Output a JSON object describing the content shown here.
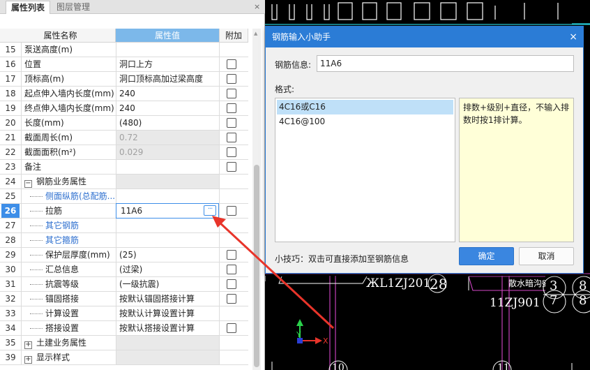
{
  "panel": {
    "tabs": [
      "属性列表",
      "图层管理"
    ],
    "close_icon": "×",
    "columns": {
      "name": "属性名称",
      "value": "属性值",
      "extra": "附加"
    },
    "rows": [
      {
        "num": "15",
        "name": "泵送高度(m)",
        "value": "",
        "check": false,
        "style": ""
      },
      {
        "num": "16",
        "name": "位置",
        "value": "洞口上方",
        "check": true,
        "style": ""
      },
      {
        "num": "17",
        "name": "顶标高(m)",
        "value": "洞口顶标高加过梁高度",
        "check": true,
        "style": ""
      },
      {
        "num": "18",
        "name": "起点伸入墙内长度(mm)",
        "value": "240",
        "check": true,
        "style": ""
      },
      {
        "num": "19",
        "name": "终点伸入墙内长度(mm)",
        "value": "240",
        "check": true,
        "style": ""
      },
      {
        "num": "20",
        "name": "长度(mm)",
        "value": "(480)",
        "check": true,
        "style": ""
      },
      {
        "num": "21",
        "name": "截面周长(m)",
        "value": "0.72",
        "check": true,
        "style": "gray"
      },
      {
        "num": "22",
        "name": "截面面积(m²)",
        "value": "0.029",
        "check": true,
        "style": "gray"
      },
      {
        "num": "23",
        "name": "备注",
        "value": "",
        "check": true,
        "style": ""
      },
      {
        "num": "24",
        "name": "钢筋业务属性",
        "value": "",
        "check": false,
        "style": "group-open"
      },
      {
        "num": "25",
        "name": "侧面纵筋(总配筋...",
        "value": "",
        "check": false,
        "style": "child-blue"
      },
      {
        "num": "26",
        "name": "拉筋",
        "value": "11A6",
        "check": true,
        "style": "child-active"
      },
      {
        "num": "27",
        "name": "其它钢筋",
        "value": "",
        "check": false,
        "style": "child-blue"
      },
      {
        "num": "28",
        "name": "其它箍筋",
        "value": "",
        "check": false,
        "style": "child-blue"
      },
      {
        "num": "29",
        "name": "保护层厚度(mm)",
        "value": "(25)",
        "check": true,
        "style": "child"
      },
      {
        "num": "30",
        "name": "汇总信息",
        "value": "(过梁)",
        "check": true,
        "style": "child"
      },
      {
        "num": "31",
        "name": "抗震等级",
        "value": "(一级抗震)",
        "check": true,
        "style": "child"
      },
      {
        "num": "32",
        "name": "锚固搭接",
        "value": "按默认锚固搭接计算",
        "check": true,
        "style": "child"
      },
      {
        "num": "33",
        "name": "计算设置",
        "value": "按默认计算设置计算",
        "check": false,
        "style": "child"
      },
      {
        "num": "34",
        "name": "搭接设置",
        "value": "按默认搭接设置计算",
        "check": true,
        "style": "child"
      },
      {
        "num": "35",
        "name": "土建业务属性",
        "value": "",
        "check": false,
        "style": "group-closed"
      },
      {
        "num": "39",
        "name": "显示样式",
        "value": "",
        "check": false,
        "style": "group-closed"
      }
    ],
    "expander_open": "−",
    "expander_closed": "+",
    "dots_icon": "···"
  },
  "dialog": {
    "title": "钢筋输入小助手",
    "close_icon": "×",
    "info_label": "钢筋信息:",
    "info_value": "11A6",
    "format_label": "格式:",
    "formats": [
      "4C16或C16",
      "4C16@100"
    ],
    "tip": "排数+级别+直径，不输入排数时按1排计算。",
    "hint": "小技巧：双击可直接添加至钢筋信息",
    "ok": "确定",
    "cancel": "取消"
  },
  "cad": {
    "labels": [
      "ЖL1ZJ201",
      "28",
      "散水暗沟§",
      "3",
      "8",
      "11ZJ901",
      "7",
      "8",
      "10",
      "11"
    ],
    "axis_y": "Y",
    "axis_x": "X"
  },
  "colors": {
    "accent": "#2b7cd6",
    "arrow": "#e8342a",
    "highlight": "#7cb8ea"
  }
}
